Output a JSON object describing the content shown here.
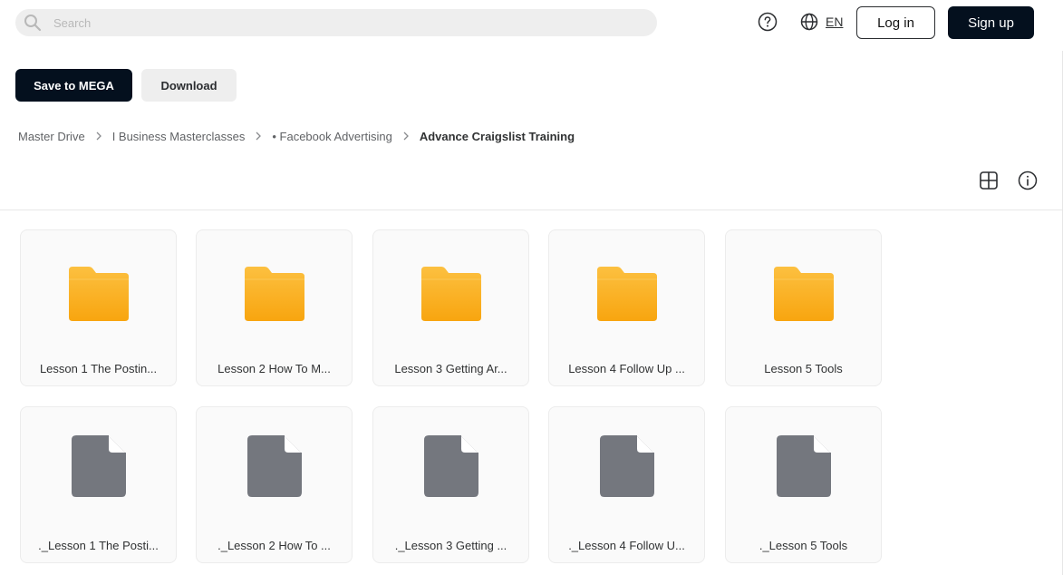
{
  "header": {
    "search_placeholder": "Search",
    "language": "EN",
    "login_label": "Log in",
    "signup_label": "Sign up"
  },
  "actions": {
    "save_label": "Save to MEGA",
    "download_label": "Download"
  },
  "breadcrumb": {
    "items": [
      "Master Drive",
      "I Business Masterclasses",
      "• Facebook Advertising"
    ],
    "current": "Advance Craigslist Training"
  },
  "folders": [
    {
      "name": "Lesson 1 The Postin...",
      "icon": "folder-icon"
    },
    {
      "name": "Lesson 2 How To M...",
      "icon": "folder-icon"
    },
    {
      "name": "Lesson 3 Getting Ar...",
      "icon": "folder-icon"
    },
    {
      "name": "Lesson 4 Follow Up ...",
      "icon": "folder-icon"
    },
    {
      "name": "Lesson 5 Tools",
      "icon": "folder-icon"
    }
  ],
  "files": [
    {
      "name": "._Lesson 1 The Posti...",
      "icon": "file-icon"
    },
    {
      "name": "._Lesson 2 How To ...",
      "icon": "file-icon"
    },
    {
      "name": "._Lesson 3 Getting ...",
      "icon": "file-icon"
    },
    {
      "name": "._Lesson 4 Follow U...",
      "icon": "file-icon"
    },
    {
      "name": "._Lesson 5 Tools",
      "icon": "file-icon"
    }
  ],
  "colors": {
    "primary_dark": "#04101e",
    "folder_yellow": "#fbb12e",
    "file_grey": "#74777e"
  }
}
